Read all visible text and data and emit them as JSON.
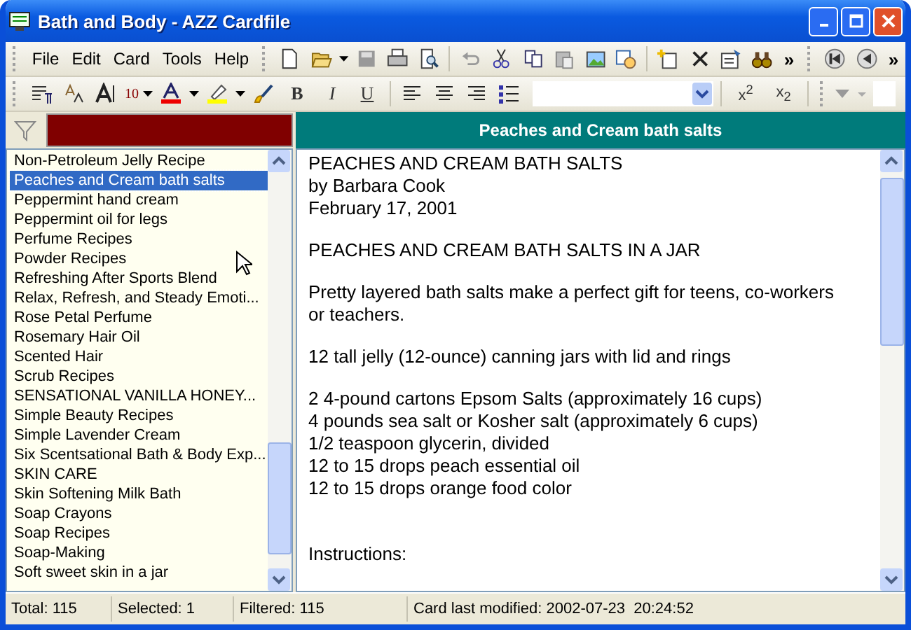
{
  "window": {
    "title": "Bath and Body - AZZ Cardfile"
  },
  "menu": [
    {
      "label": "File"
    },
    {
      "label": "Edit"
    },
    {
      "label": "Card"
    },
    {
      "label": "Tools"
    },
    {
      "label": "Help"
    }
  ],
  "toolbar": {
    "overflow": "»",
    "nav_overflow": "»"
  },
  "format_bar": {
    "font_size": "10",
    "bold": "B",
    "italic": "I",
    "underline": "U",
    "superscript": "x$^{2}$",
    "subscript": "x$_{2}$"
  },
  "list": {
    "items": [
      {
        "label": "Non-Petroleum Jelly Recipe",
        "selected": false
      },
      {
        "label": "Peaches and Cream bath salts",
        "selected": true
      },
      {
        "label": "Peppermint hand cream",
        "selected": false
      },
      {
        "label": "Peppermint oil for legs",
        "selected": false
      },
      {
        "label": "Perfume Recipes",
        "selected": false
      },
      {
        "label": "Powder Recipes",
        "selected": false
      },
      {
        "label": "Refreshing After Sports Blend",
        "selected": false
      },
      {
        "label": "Relax, Refresh, and Steady Emoti...",
        "selected": false
      },
      {
        "label": "Rose Petal Perfume",
        "selected": false
      },
      {
        "label": "Rosemary Hair Oil",
        "selected": false
      },
      {
        "label": "Scented Hair",
        "selected": false
      },
      {
        "label": "Scrub Recipes",
        "selected": false
      },
      {
        "label": "SENSATIONAL VANILLA HONEY...",
        "selected": false
      },
      {
        "label": "Simple Beauty Recipes",
        "selected": false
      },
      {
        "label": "Simple Lavender Cream",
        "selected": false
      },
      {
        "label": "Six Scentsational Bath & Body Exp...",
        "selected": false
      },
      {
        "label": "SKIN CARE",
        "selected": false
      },
      {
        "label": "Skin Softening Milk Bath",
        "selected": false
      },
      {
        "label": "Soap Crayons",
        "selected": false
      },
      {
        "label": "Soap Recipes",
        "selected": false
      },
      {
        "label": "Soap-Making",
        "selected": false
      },
      {
        "label": "Soft sweet skin in a jar",
        "selected": false
      }
    ]
  },
  "card": {
    "title": "Peaches and Cream bath salts",
    "paragraphs": [
      {
        "lines": [
          "PEACHES AND CREAM BATH SALTS",
          "by Barbara Cook",
          "February 17, 2001"
        ]
      },
      {
        "lines": [
          "PEACHES AND CREAM BATH SALTS IN A JAR"
        ]
      },
      {
        "lines": [
          "Pretty layered bath salts make a perfect gift for teens, co-workers",
          "or teachers."
        ]
      },
      {
        "lines": [
          "12 tall jelly (12-ounce) canning jars with lid and rings"
        ]
      },
      {
        "lines": [
          "2 4-pound cartons Epsom Salts (approximately 16 cups)",
          "4 pounds sea salt or Kosher salt (approximately 6 cups)",
          "1/2 teaspoon glycerin, divided",
          "12 to 15 drops peach essential oil",
          "12 to 15 drops orange food color"
        ]
      }
    ],
    "section_heading": "Instructions:"
  },
  "status_bar": [
    {
      "text": "Total: 115"
    },
    {
      "text": "Selected: 1"
    },
    {
      "text": "Filtered: 115"
    },
    {
      "text": "Card last modified: 2002-07-23  20:24:52"
    }
  ]
}
